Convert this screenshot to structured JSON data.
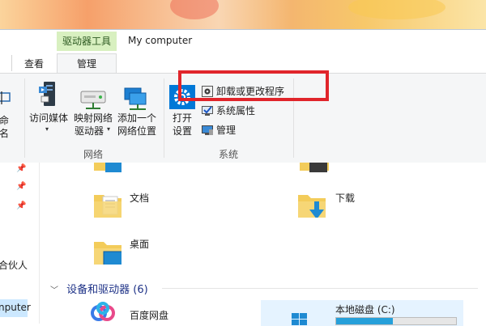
{
  "window": {
    "title": "My computer",
    "context_tab_header": "驱动器工具"
  },
  "tabs": {
    "view": "查看",
    "manage": "管理"
  },
  "ribbon": {
    "rename_label": "命名",
    "network_group_label": "网络",
    "system_group_label": "系统",
    "access_media": {
      "label": "访问媒体",
      "icon": "media-server-icon"
    },
    "map_drive": {
      "line1": "映射网络",
      "line2": "驱动器",
      "icon": "network-drive-icon"
    },
    "add_location": {
      "line1": "添加一个",
      "line2": "网络位置",
      "icon": "network-location-icon"
    },
    "open_settings": {
      "line1": "打开",
      "line2": "设置",
      "icon": "gear-icon"
    },
    "uninstall": {
      "label": "卸载或更改程序",
      "icon": "uninstall-icon"
    },
    "system_properties": {
      "label": "系统属性",
      "icon": "checkmark-monitor-icon"
    },
    "manage": {
      "label": "管理",
      "icon": "computer-manage-icon"
    }
  },
  "nav": {
    "partner_label": "合伙人",
    "selected_label": "nputer"
  },
  "folders": {
    "documents": "文档",
    "downloads": "下载",
    "desktop": "桌面"
  },
  "devices": {
    "section_title": "设备和驱动器 (6)",
    "baidu": "百度网盘",
    "local_disk": {
      "label": "本地磁盘 (C:)",
      "used_fraction": 0.47
    }
  },
  "colors": {
    "accent": "#0078d7",
    "highlight_box": "#e0252b",
    "context_tab": "#d8f0c0"
  }
}
